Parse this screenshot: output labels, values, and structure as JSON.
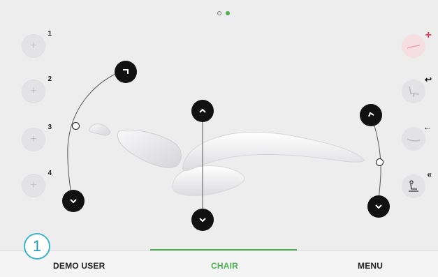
{
  "pager": {
    "pages": 2,
    "current": 2
  },
  "presets": [
    {
      "number": "1",
      "icon": "plus-icon"
    },
    {
      "number": "2",
      "icon": "plus-icon"
    },
    {
      "number": "3",
      "icon": "plus-icon"
    },
    {
      "number": "4",
      "icon": "plus-icon"
    }
  ],
  "side_actions": [
    {
      "name": "add-position",
      "badge": "+",
      "icon": "chair-reclined-icon"
    },
    {
      "name": "spittoon-position",
      "badge": "↩",
      "icon": "chair-sitting-icon"
    },
    {
      "name": "return-position",
      "badge": "←",
      "icon": "chair-flat-icon"
    },
    {
      "name": "last-position",
      "badge": "«",
      "icon": "chair-person-icon"
    }
  ],
  "nav": {
    "user_number": "1",
    "tabs": [
      {
        "label": "DEMO USER",
        "active": false
      },
      {
        "label": "CHAIR",
        "active": true
      },
      {
        "label": "MENU",
        "active": false
      }
    ]
  },
  "colors": {
    "accent": "#4caf50",
    "user_ring": "#3bb5c9",
    "add_badge": "#e0385a",
    "control": "#111111"
  }
}
